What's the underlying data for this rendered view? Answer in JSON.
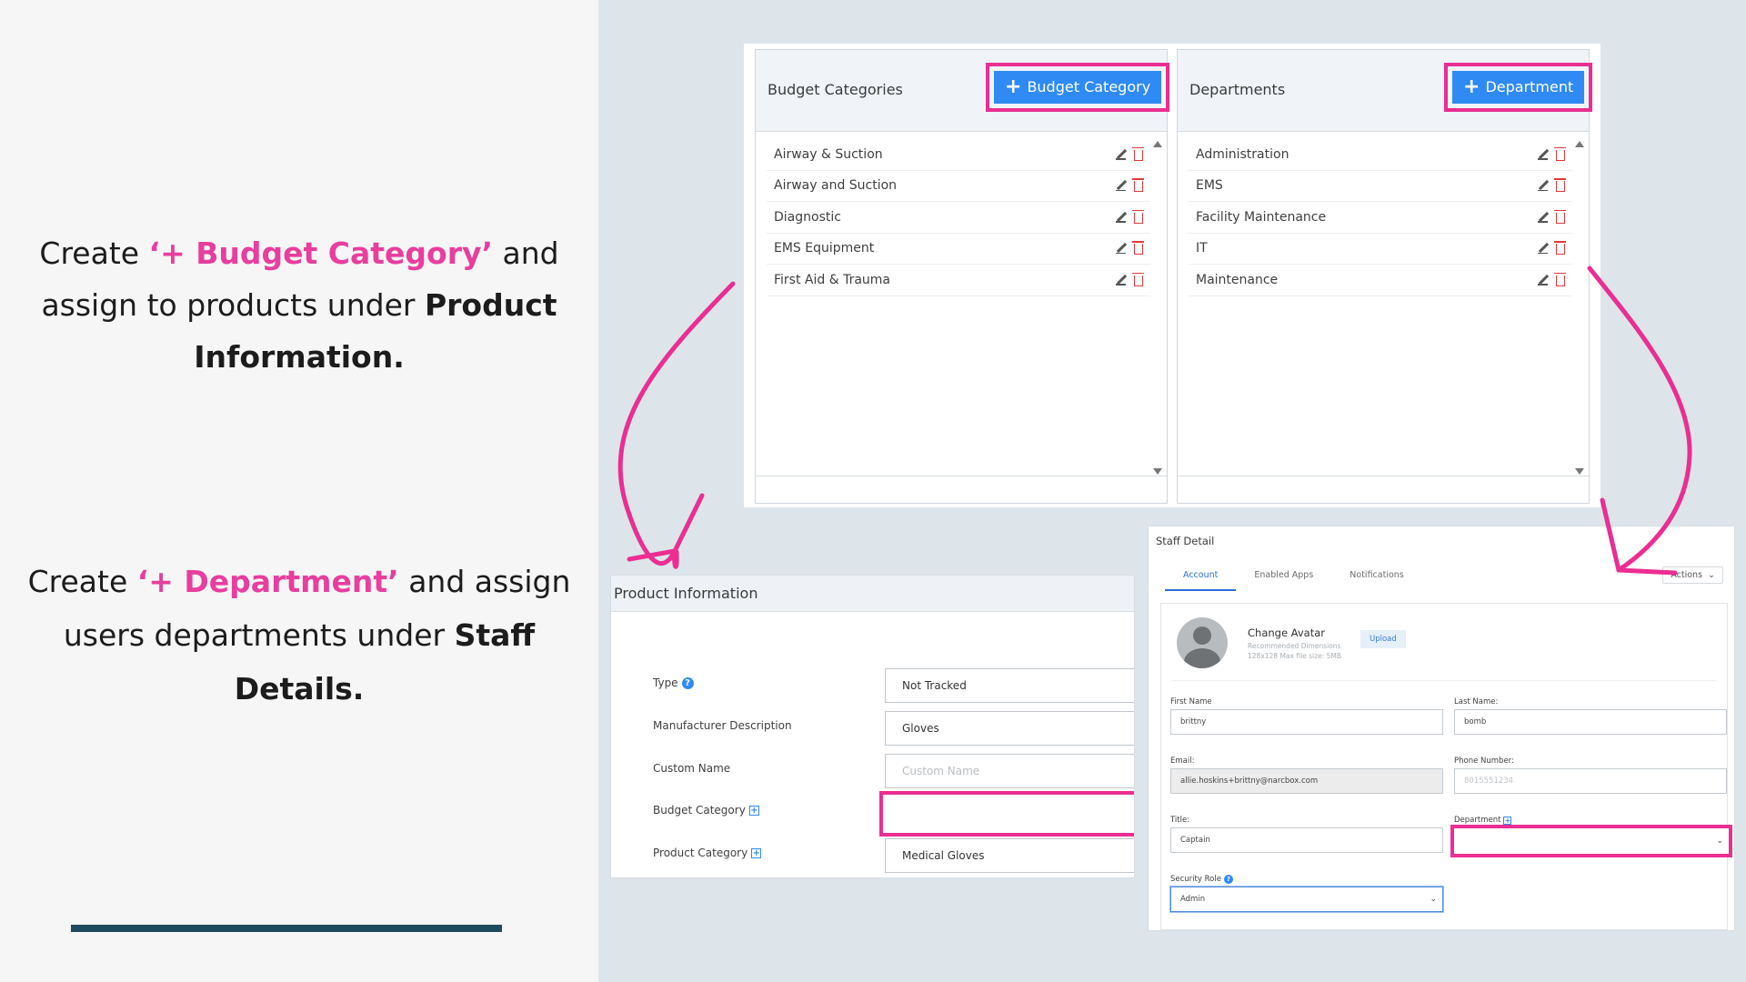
{
  "instructions": [
    {
      "pre": "Create ",
      "accent": "‘+ Budget Category’",
      "mid": " and assign to products under ",
      "strong": "Product Information."
    },
    {
      "pre": "Create ",
      "accent": "‘+ Department’",
      "mid": " and assign users departments under ",
      "strong": "Staff Details."
    }
  ],
  "colors": {
    "accent": "#e83e9e",
    "highlight_border": "#ea2e92",
    "button_blue": "#2f8af3",
    "bar": "#1e4a5e"
  },
  "budget_categories": {
    "title": "Budget Categories",
    "add_button": "Budget Category",
    "items": [
      "Airway & Suction",
      "Airway and Suction",
      "Diagnostic",
      "EMS Equipment",
      "First Aid & Trauma"
    ]
  },
  "departments": {
    "title": "Departments",
    "add_button": "Department",
    "items": [
      "Administration",
      "EMS",
      "Facility Maintenance",
      "IT",
      "Maintenance"
    ]
  },
  "product_information": {
    "title": "Product Information",
    "fields": [
      {
        "label": "Type",
        "value": "Not Tracked",
        "icon": "help-icon"
      },
      {
        "label": "Manufacturer Description",
        "value": "Gloves"
      },
      {
        "label": "Custom Name",
        "placeholder": "Custom Name"
      },
      {
        "label": "Budget Category",
        "value": "",
        "icon": "plus-box-icon"
      },
      {
        "label": "Product Category",
        "value": "Medical Gloves",
        "icon": "plus-box-icon"
      }
    ]
  },
  "staff_detail": {
    "title": "Staff Detail",
    "tabs": [
      "Account",
      "Enabled Apps",
      "Notifications"
    ],
    "actions_label": "Actions",
    "change_avatar": "Change Avatar",
    "avatar_hint_1": "Recommended Dimensions",
    "avatar_hint_2": "128x128 Max file size: 5MB",
    "upload_label": "Upload",
    "first_name_label": "First Name",
    "first_name": "brittny",
    "last_name_label": "Last Name:",
    "last_name": "bomb",
    "email_label": "Email:",
    "email": "allie.hoskins+brittny@narcbox.com",
    "phone_label": "Phone Number:",
    "phone_placeholder": "8015551234",
    "title_label": "Title:",
    "title_value": "Captain",
    "department_label": "Department",
    "department_value": "",
    "security_role_label": "Security Role",
    "security_role": "Admin"
  }
}
